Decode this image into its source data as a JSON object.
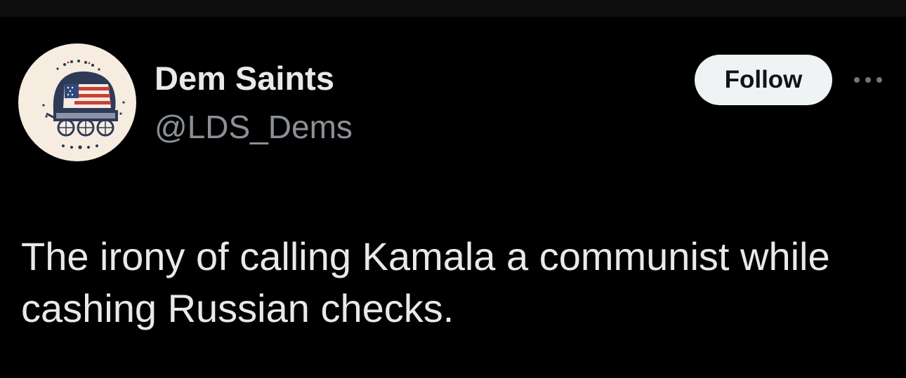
{
  "tweet": {
    "author": {
      "display_name": "Dem Saints",
      "handle": "@LDS_Dems",
      "avatar_icon": "covered-wagon-flag-logo"
    },
    "follow_label": "Follow",
    "more_icon": "more-options-icon",
    "text": "The irony of calling Kamala a communist while cashing Russian checks."
  },
  "colors": {
    "background": "#000000",
    "primary_text": "#e7e9ea",
    "secondary_text": "#8b9096",
    "follow_button_bg": "#eff3f4",
    "follow_button_text": "#0f1419",
    "avatar_bg": "#f6ece0"
  }
}
